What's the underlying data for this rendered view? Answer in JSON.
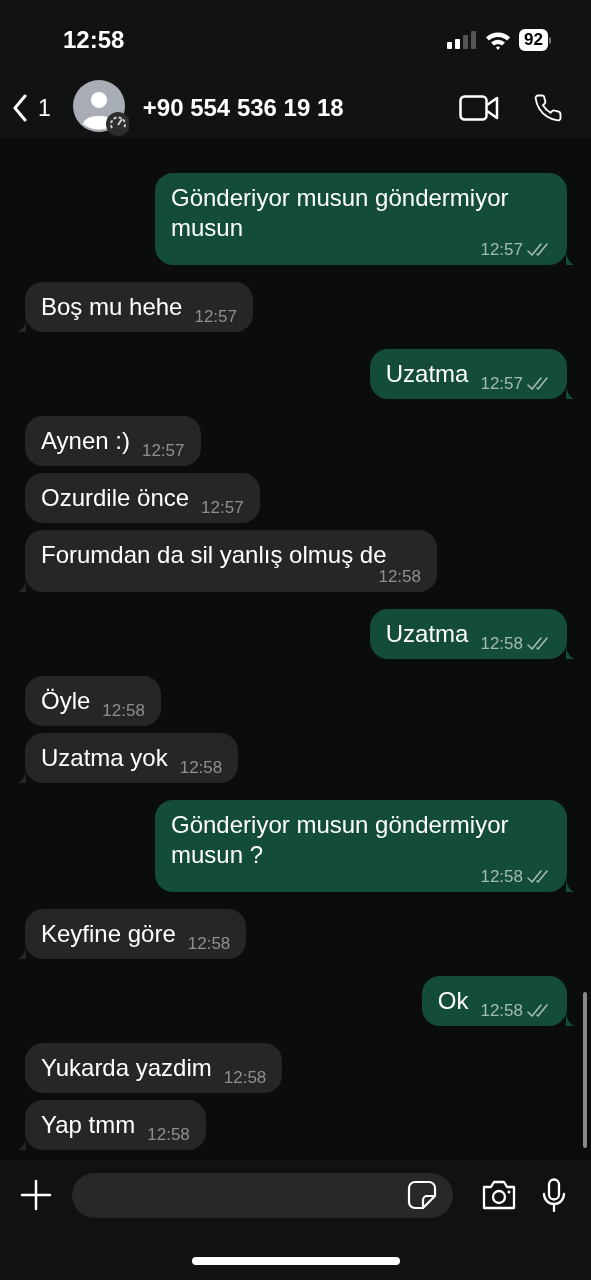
{
  "status_bar": {
    "time": "12:58",
    "battery": "92"
  },
  "header": {
    "back_count": "1",
    "contact": "+90 554 536 19 18"
  },
  "messages": [
    {
      "kind": "outgoing",
      "text": "Gönderiyor musun göndermiyor musun",
      "time": "12:57"
    },
    {
      "kind": "incoming",
      "text": "Boş mu hehe",
      "time": "12:57"
    },
    {
      "kind": "outgoing",
      "text": "Uzatma",
      "time": "12:57"
    },
    {
      "kind": "incoming",
      "text": "Aynen :)",
      "time": "12:57"
    },
    {
      "kind": "incoming",
      "text": "Ozurdile önce",
      "time": "12:57"
    },
    {
      "kind": "incoming",
      "text": "Forumdan da sil yanlış olmuş de",
      "time": "12:58"
    },
    {
      "kind": "outgoing",
      "text": "Uzatma",
      "time": "12:58"
    },
    {
      "kind": "incoming",
      "text": "Öyle",
      "time": "12:58"
    },
    {
      "kind": "incoming",
      "text": "Uzatma yok",
      "time": "12:58"
    },
    {
      "kind": "outgoing",
      "text": "Gönderiyor musun göndermiyor musun ?",
      "time": "12:58"
    },
    {
      "kind": "incoming",
      "text": "Keyfine göre",
      "time": "12:58"
    },
    {
      "kind": "outgoing",
      "text": "Ok",
      "time": "12:58"
    },
    {
      "kind": "incoming",
      "text": "Yukarda yazdim",
      "time": "12:58"
    },
    {
      "kind": "incoming",
      "text": "Yap tmm",
      "time": "12:58"
    }
  ]
}
